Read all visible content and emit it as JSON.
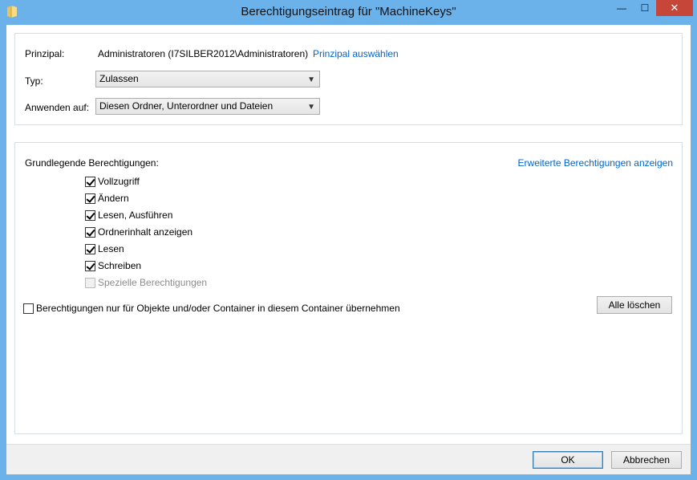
{
  "window": {
    "title": "Berechtigungseintrag für \"MachineKeys\"",
    "min_glyph": "—",
    "max_glyph": "☐",
    "close_glyph": "✕"
  },
  "principal": {
    "label": "Prinzipal:",
    "value": "Administratoren (I7SILBER2012\\Administratoren)",
    "link": "Prinzipal auswählen"
  },
  "type": {
    "label": "Typ:",
    "value": "Zulassen"
  },
  "apply_to": {
    "label": "Anwenden auf:",
    "value": "Diesen Ordner, Unterordner und Dateien"
  },
  "permissions": {
    "heading": "Grundlegende Berechtigungen:",
    "advanced_link": "Erweiterte Berechtigungen anzeigen",
    "items": [
      {
        "label": "Vollzugriff",
        "checked": true,
        "enabled": true
      },
      {
        "label": "Ändern",
        "checked": true,
        "enabled": true
      },
      {
        "label": "Lesen, Ausführen",
        "checked": true,
        "enabled": true
      },
      {
        "label": "Ordnerinhalt anzeigen",
        "checked": true,
        "enabled": true
      },
      {
        "label": "Lesen",
        "checked": true,
        "enabled": true
      },
      {
        "label": "Schreiben",
        "checked": true,
        "enabled": true
      },
      {
        "label": "Spezielle Berechtigungen",
        "checked": false,
        "enabled": false
      }
    ],
    "inherit_label": "Berechtigungen nur für Objekte und/oder Container in diesem Container übernehmen",
    "inherit_checked": false,
    "clear_all_label": "Alle löschen"
  },
  "footer": {
    "ok_label": "OK",
    "cancel_label": "Abbrechen"
  },
  "colors": {
    "frame": "#6cb2ea",
    "close": "#c7463a",
    "link": "#0066cc"
  }
}
